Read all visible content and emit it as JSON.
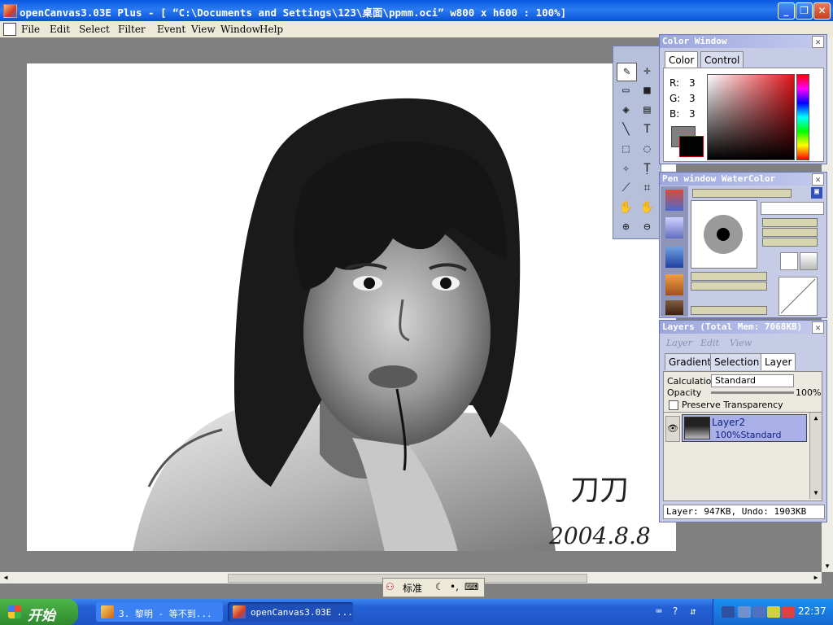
{
  "window": {
    "title": "openCanvas3.03E Plus - [ “C:\\Documents and Settings\\123\\桌面\\ppmm.oci” w800 x h600 : 100%]",
    "minimize": "_",
    "maximize": "❐",
    "close": "✕"
  },
  "menubar": {
    "items": [
      "File",
      "Edit",
      "Select",
      "Filter",
      "Event",
      "View",
      "Window",
      "Help"
    ]
  },
  "canvas": {
    "signature": "刀刀",
    "date": "2004.8.8"
  },
  "color_window": {
    "title": "Color Window",
    "tabs": [
      "Color",
      "Control"
    ],
    "r_label": "R:",
    "r_value": "3",
    "g_label": "G:",
    "g_value": "3",
    "b_label": "B:",
    "b_value": "3",
    "foreground": "#030303",
    "background": "#808080"
  },
  "pen_window": {
    "title": "Pen window  WaterColor"
  },
  "layers_window": {
    "title": "Layers (Total Mem: 7068KB)",
    "menu": [
      "Layer",
      "Edit",
      "View"
    ],
    "tabs": [
      "Gradient",
      "Selection",
      "Layer"
    ],
    "calculation_label": "Calculation",
    "calculation_value": "Standard",
    "opacity_label": "Opacity",
    "opacity_value": "100%",
    "preserve_label": "Preserve Transparency",
    "layer_name": "Layer2",
    "layer_mode": "100%Standard",
    "status": "Layer: 947KB, Undo: 1903KB"
  },
  "ime": {
    "mode": "标准"
  },
  "taskbar": {
    "start": "开始",
    "tasks": [
      "3. 黎明 - 等不到...",
      "openCanvas3.03E ..."
    ],
    "clock": "22:37"
  }
}
